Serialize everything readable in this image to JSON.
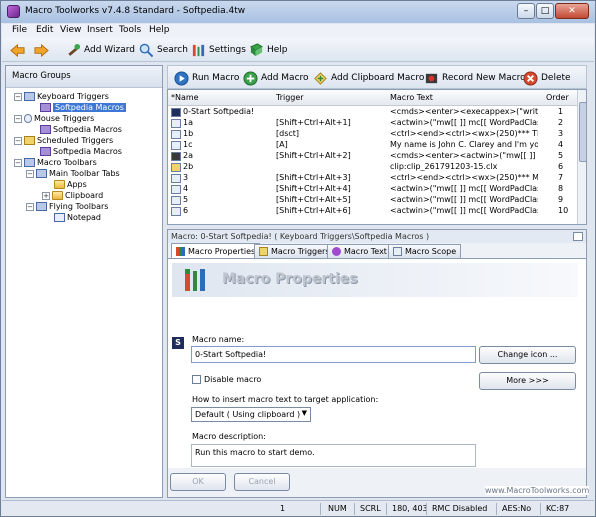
{
  "window": {
    "title": "Macro Toolworks v7.4.8 Standard - Softpedia.4tw",
    "min": "–",
    "max": "□",
    "close": "✕"
  },
  "menu": [
    "File",
    "Edit",
    "View",
    "Insert",
    "Tools",
    "Help"
  ],
  "toolbar": {
    "back": "",
    "forward": "",
    "add_wizard": "Add Wizard",
    "search": "Search",
    "settings": "Settings",
    "help": "Help"
  },
  "left_pane": {
    "title": "Macro Groups",
    "tree": [
      {
        "label": "Keyboard Triggers",
        "expander": "−"
      },
      {
        "label": "Softpedia Macros"
      },
      {
        "label": "Mouse Triggers",
        "expander": "−"
      },
      {
        "label": "Softpedia Macros"
      },
      {
        "label": "Scheduled Triggers",
        "expander": "−"
      },
      {
        "label": "Softpedia Macros"
      },
      {
        "label": "Macro Toolbars",
        "expander": "−"
      },
      {
        "label": "Main Toolbar Tabs",
        "expander": "−"
      },
      {
        "label": "Apps"
      },
      {
        "label": "Clipboard",
        "expander": "+"
      },
      {
        "label": "Flying Toolbars",
        "expander": "−"
      },
      {
        "label": "Notepad"
      }
    ]
  },
  "actions": {
    "run": "Run Macro",
    "add": "Add Macro",
    "add_clip": "Add Clipboard Macro",
    "record": "Record New Macro",
    "delete": "Delete"
  },
  "grid": {
    "headers": [
      "*Name",
      "Trigger",
      "Macro Text",
      "Order"
    ],
    "rows": [
      {
        "name": "0-Start Softpedia!",
        "trigger": "",
        "text": "<cmds><enter><execappex>(\"write.exe\",...",
        "order": "1"
      },
      {
        "name": "1a",
        "trigger": "[Shift+Ctrl+Alt+1]",
        "text": "<actwin>(\"mw[[  ]] mc[[ WordPadClass ]] ...",
        "order": "2"
      },
      {
        "name": "1b",
        "trigger": "[dsct]",
        "text": "<ctrl><end><ctrl><wx>(250)*** TEXT SH...",
        "order": "3"
      },
      {
        "name": "1c",
        "trigger": "[A]",
        "text": "My name is John C. Clarey and I'm your c...",
        "order": "4"
      },
      {
        "name": "2a",
        "trigger": "[Shift+Ctrl+Alt+2]",
        "text": "<cmds><enter><actwin>(\"mw[[  ]] mc[[ Wd...",
        "order": "5"
      },
      {
        "name": "2b",
        "trigger": "",
        "text": "clip:clip_261791203-15.clx",
        "order": "6"
      },
      {
        "name": "3",
        "trigger": "[Shift+Ctrl+Alt+3]",
        "text": "<ctrl><end><ctrl><wx>(250)*** MACRO R...",
        "order": "7"
      },
      {
        "name": "4",
        "trigger": "[Shift+Ctrl+Alt+4]",
        "text": "<actwin>(\"mw[[  ]] mc[[ WordPadClass ]] ...",
        "order": "8"
      },
      {
        "name": "5",
        "trigger": "[Shift+Ctrl+Alt+5]",
        "text": "<actwin>(\"mw[[  ]] mc[[ WordPadClass ]] ...",
        "order": "9"
      },
      {
        "name": "6",
        "trigger": "[Shift+Ctrl+Alt+6]",
        "text": "<actwin>(\"mw[[  ]] mc[[ WordPadClass ]] ...",
        "order": "10"
      }
    ]
  },
  "props": {
    "caption": "Macro: 0-Start Softpedia! ( Keyboard Triggers\\Softpedia Macros )",
    "tabs": [
      "Macro Properties",
      "Macro Triggers",
      "Macro Text",
      "Macro Scope"
    ],
    "banner": "Macro Properties",
    "name_label": "Macro name:",
    "name_value": "0-Start Softpedia!",
    "change_icon": "Change icon ...",
    "disable_label": "Disable macro",
    "more": "More >>>",
    "insert_label": "How to insert macro text to target application:",
    "insert_value": "Default ( Using clipboard )",
    "desc_label": "Macro description:",
    "desc_value": "Run this macro to start demo.",
    "ok": "OK",
    "cancel": "Cancel"
  },
  "status": {
    "count": "1",
    "num": "NUM",
    "scrl": "SCRL",
    "coords": "180, 403",
    "rmc": "RMC Disabled",
    "aes": "AES:No",
    "kc": "KC:87"
  },
  "watermark": {
    "url": "www.MacroToolworks.com"
  }
}
